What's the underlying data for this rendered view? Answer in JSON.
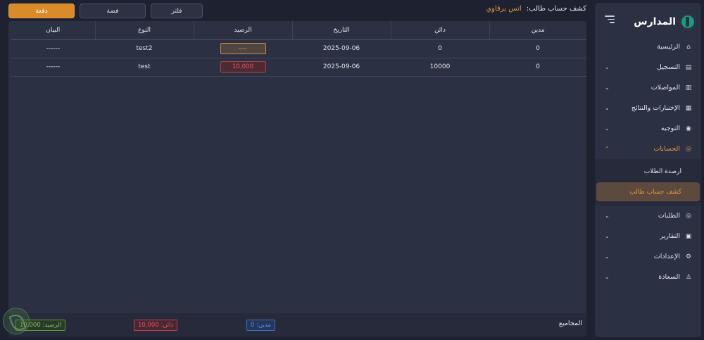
{
  "brand": {
    "name": "المدارس"
  },
  "sidebar": {
    "items": [
      {
        "label": "الرئيسية",
        "icon": "home-icon",
        "has_children": false
      },
      {
        "label": "التسجيل",
        "icon": "book-icon",
        "has_children": true
      },
      {
        "label": "المواصلات",
        "icon": "bus-icon",
        "has_children": true
      },
      {
        "label": "الإختبارات والنتائج",
        "icon": "exam-icon",
        "has_children": true
      },
      {
        "label": "التوجيه",
        "icon": "compass-icon",
        "has_children": true
      },
      {
        "label": "الحسابات",
        "icon": "coins-icon",
        "has_children": true,
        "expanded": true
      },
      {
        "label": "الطلبات",
        "icon": "orders-icon",
        "has_children": true
      },
      {
        "label": "التقارير",
        "icon": "report-icon",
        "has_children": true
      },
      {
        "label": "الإعدادات",
        "icon": "gear-icon",
        "has_children": true
      },
      {
        "label": "السعادة",
        "icon": "user-icon",
        "has_children": true
      }
    ],
    "accounts_submenu": [
      {
        "label": "ارصدة الطلاب",
        "active": false
      },
      {
        "label": "كشف حساب طالب",
        "active": true
      }
    ]
  },
  "header": {
    "title_prefix": "كشف حساب طالب:",
    "student_name": "انس برقاوي"
  },
  "toolbar": {
    "payment_label": "دفعة",
    "silver_label": "فضة",
    "filter_label": "فلتر"
  },
  "table": {
    "columns": [
      "مدين",
      "دائن",
      "التاريخ",
      "الرصيد",
      "النوع",
      "البيان"
    ],
    "rows": [
      {
        "debit": "0",
        "credit": "0",
        "date": "2025-09-06",
        "balance": "----",
        "balance_state": "neutral",
        "type": "test2",
        "statement": "------"
      },
      {
        "debit": "0",
        "credit": "10000",
        "date": "2025-09-06",
        "balance": "10,000",
        "balance_state": "negative",
        "type": "test",
        "statement": "------"
      }
    ]
  },
  "totals": {
    "label": "المجاميع",
    "debit": "مدين: 0",
    "credit": "دائن: 10,000",
    "balance": "الرصيد: 10,000"
  },
  "colors": {
    "accent": "#e39a3b",
    "background": "#1e2230",
    "panel": "#2b3043",
    "debit": "#5b93f0",
    "credit": "#e2575f",
    "balance": "#89c25c"
  }
}
